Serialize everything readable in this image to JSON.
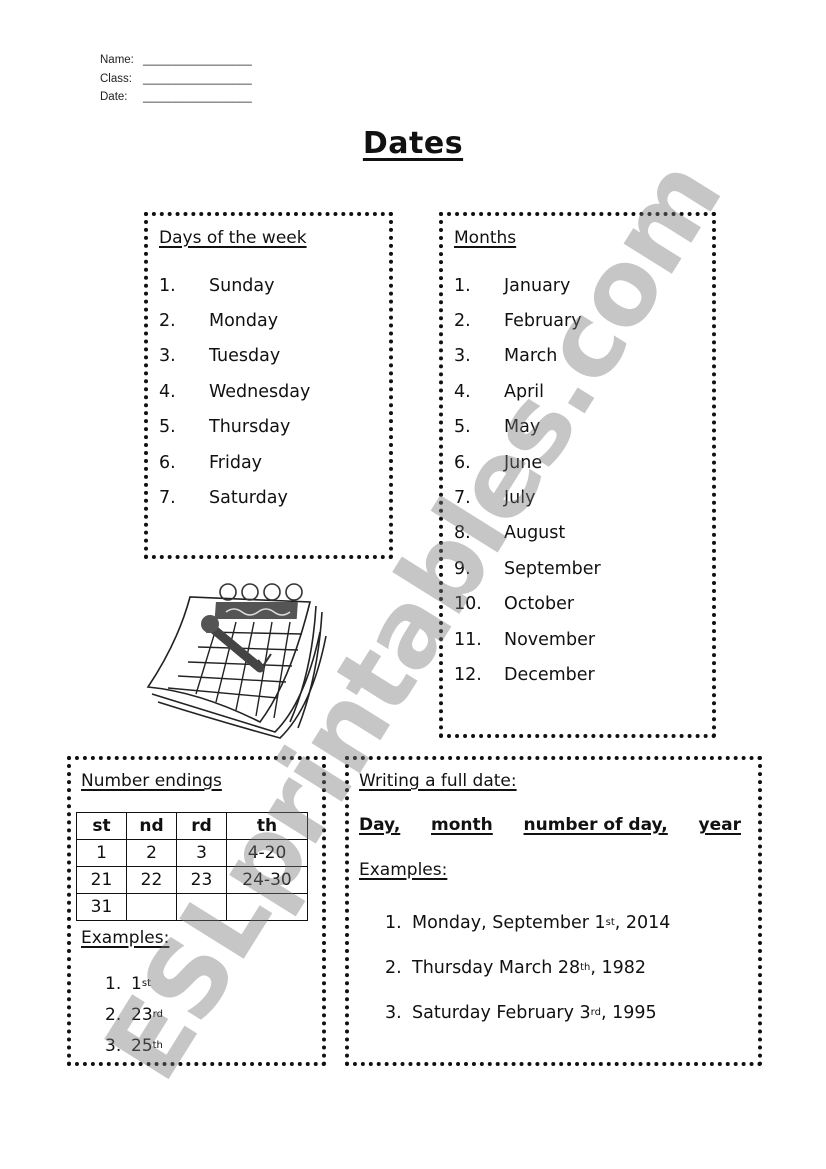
{
  "header": {
    "fields": [
      {
        "label": "Name:",
        "blank": "_________________"
      },
      {
        "label": "Class:",
        "blank": "_________________"
      },
      {
        "label": "Date:",
        "blank": "_________________"
      }
    ]
  },
  "title": "Dates",
  "days_box": {
    "heading": "Days of the week",
    "items": [
      {
        "num": "1.",
        "text": "Sunday"
      },
      {
        "num": "2.",
        "text": "Monday"
      },
      {
        "num": "3.",
        "text": "Tuesday"
      },
      {
        "num": "4.",
        "text": "Wednesday"
      },
      {
        "num": "5.",
        "text": "Thursday"
      },
      {
        "num": "6.",
        "text": "Friday"
      },
      {
        "num": "7.",
        "text": "Saturday"
      }
    ]
  },
  "months_box": {
    "heading": "Months",
    "items": [
      {
        "num": "1.",
        "text": "January"
      },
      {
        "num": "2.",
        "text": "February"
      },
      {
        "num": "3.",
        "text": "March"
      },
      {
        "num": "4.",
        "text": "April"
      },
      {
        "num": "5.",
        "text": "May"
      },
      {
        "num": "6.",
        "text": "June"
      },
      {
        "num": "7.",
        "text": "July"
      },
      {
        "num": "8.",
        "text": "August"
      },
      {
        "num": "9.",
        "text": "September"
      },
      {
        "num": "10.",
        "text": "October"
      },
      {
        "num": "11.",
        "text": "November"
      },
      {
        "num": "12.",
        "text": "December"
      }
    ]
  },
  "endings_box": {
    "heading": "Number endings",
    "table": {
      "headers": [
        "st",
        "nd",
        "rd",
        "th"
      ],
      "rows": [
        [
          "1",
          "2",
          "3",
          "4-20"
        ],
        [
          "21",
          "22",
          "23",
          "24-30"
        ],
        [
          "31",
          "",
          "",
          ""
        ]
      ]
    },
    "examples_heading": "Examples:",
    "examples": [
      {
        "num": "1.",
        "base": "1",
        "suffix": "st"
      },
      {
        "num": "2.",
        "base": "23",
        "suffix": "rd"
      },
      {
        "num": "3.",
        "base": "25",
        "suffix": "th"
      }
    ]
  },
  "full_date_box": {
    "heading": "Writing a full date:",
    "formula": [
      "Day,",
      "month",
      "number of day,",
      "year"
    ],
    "examples_heading": "Examples:",
    "examples": [
      {
        "num": "1.",
        "before": "Monday, September 1",
        "suffix": "st",
        "after": ", 2014"
      },
      {
        "num": "2.",
        "before": "Thursday March 28",
        "suffix": "th",
        "after": ", 1982"
      },
      {
        "num": "3.",
        "before": "Saturday February 3",
        "suffix": "rd",
        "after": ", 1995"
      }
    ]
  },
  "clipart": {
    "icon": "calendar-with-pen-icon"
  },
  "watermark": "ESLprintables.com"
}
